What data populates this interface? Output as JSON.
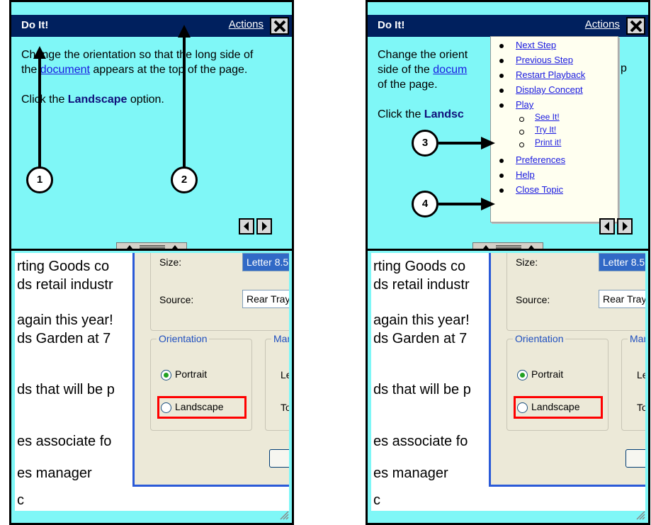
{
  "left_panel": {
    "title": "Do It!",
    "actions_label": "Actions",
    "instruction_before": "Change the orientation so that the long side of the ",
    "instruction_link": "document",
    "instruction_after": " appears at the top of the page.",
    "click_prefix": "Click the ",
    "click_target": "Landscape",
    "click_suffix": " option.",
    "callouts": [
      "1",
      "2"
    ]
  },
  "right_panel": {
    "title": "Do It!",
    "actions_label": "Actions",
    "instruction_visible_1": "Change the orient",
    "instruction_link_partial": "docum",
    "instruction_tail": "p",
    "instruction_visible_2_prefix": "side of the ",
    "instruction_visible_3": "of the page.",
    "click_partial": "Click the ",
    "click_target_partial": "Landsc",
    "callouts": [
      "3",
      "4"
    ],
    "menu": {
      "items": [
        "Next Step",
        "Previous Step",
        "Restart Playback",
        "Display Concept",
        "Play"
      ],
      "play_sub": [
        "See It!",
        "Try It!",
        "Print it!"
      ],
      "items_after": [
        "Preferences",
        "Help",
        "Close Topic"
      ]
    }
  },
  "document": {
    "lines": [
      "rting Goods co",
      "ds retail industr",
      "again this year!",
      "ds Garden at 7",
      "ds that will be p",
      "es associate fo",
      "es manager",
      "c"
    ]
  },
  "page_setup": {
    "size_label": "Size:",
    "size_value": "Letter 8.5",
    "source_label": "Source:",
    "source_value": "Rear Tray",
    "orientation_group": "Orientation",
    "margins_group": "Mar",
    "portrait_label": "Portrait",
    "landscape_label": "Landscape",
    "left_label": "Lef",
    "top_label": "To",
    "selected_orientation": "Portrait"
  },
  "colors": {
    "panel_bg": "#7ff7f7",
    "titlebar": "#00205e",
    "highlight": "#ff0000",
    "link": "#1a1ae0"
  }
}
